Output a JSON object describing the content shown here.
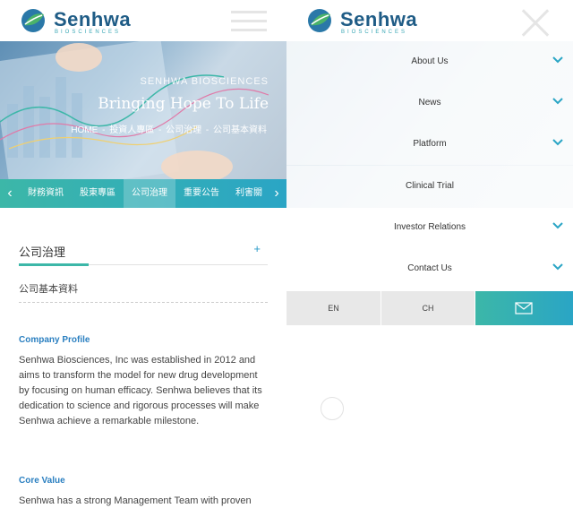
{
  "brand": {
    "name": "Senhwa",
    "tagline": "BIOSCIENCES"
  },
  "hero": {
    "subtitle": "SENHWA BIOSCIENCES",
    "title": "Bringing Hope To Life",
    "breadcrumb": [
      "HOME",
      "投資人專區",
      "公司治理",
      "公司基本資料"
    ]
  },
  "tabs": [
    "財務資訊",
    "股東專區",
    "公司治理",
    "重要公告",
    "利害關"
  ],
  "active_tab": "公司治理",
  "section": {
    "title": "公司治理",
    "plus": "+",
    "sub_item": "公司基本資料"
  },
  "profile": {
    "heading": "Company Profile",
    "text": "Senhwa Biosciences, Inc was established in 2012 and aims to transform the model for new drug development by focusing on human efficacy. Senhwa believes that its dedication to science and rigorous processes will make Senhwa achieve a remarkable milestone."
  },
  "core": {
    "heading": "Core Value",
    "text": "Senhwa has a strong Management Team with proven"
  },
  "menu": {
    "items": [
      {
        "label": "About Us",
        "has_children": true
      },
      {
        "label": "News",
        "has_children": true
      },
      {
        "label": "Platform",
        "has_children": true
      },
      {
        "label": "Clinical Trial",
        "has_children": false
      },
      {
        "label": "Investor Relations",
        "has_children": true
      },
      {
        "label": "Contact Us",
        "has_children": true
      }
    ],
    "languages": [
      "EN",
      "CH"
    ]
  },
  "colors": {
    "brand_blue": "#1f5c86",
    "accent_teal": "#3cb7a8",
    "accent_blue": "#2aa5c5",
    "link_blue": "#2a7fc0"
  }
}
